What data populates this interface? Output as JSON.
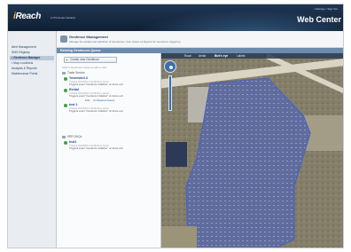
{
  "header": {
    "logo_prefix": "i",
    "logo_name": "Reach",
    "subtitle": "A ITS Series Solution",
    "top_links": "• Settings  • Sign Out",
    "app_title": "Web Center"
  },
  "sidebar": {
    "items": [
      {
        "label": "Alert Management",
        "active": false
      },
      {
        "label": "SMS Registry",
        "active": false
      },
      {
        "label": "• Geofence Manager",
        "active": true
      },
      {
        "label": "• Map Locations",
        "active": false
      },
      {
        "label": "Analysis & Reports",
        "active": false
      },
      {
        "label": "Maintenance Portal",
        "active": false
      }
    ]
  },
  "page": {
    "title": "Geofence Management",
    "description": "Manage the details and definition of Geofences, their states configured for Geofence triggering"
  },
  "section": {
    "title": "Existing Geofences Queue"
  },
  "list": {
    "create_label": "Create new Geofence",
    "hint": "Click a Geofence name to edit or view",
    "groups": [
      {
        "header": "Trade Service",
        "items": [
          {
            "name": "Yosemite4.3",
            "meta": "Created 2014/03/14 16:08:48 by admin",
            "trigger": "Triggers event \"Geofence Violation\" on fence exit",
            "links": []
          },
          {
            "name": "Rental",
            "meta": "Created 2014/03/14 16:08:48 by admin",
            "trigger": "Triggers event \"Geofence Violation\" on fence exit",
            "links": [
              "Edit",
              "Configured Assets"
            ]
          },
          {
            "name": "test 1",
            "meta": "Created 2014/03/14 16:08:48 by admin",
            "trigger": "Triggers event \"Geofence Violation\" on fence exit",
            "links": []
          }
        ]
      },
      {
        "header": "SRR DHQc",
        "items": [
          {
            "name": "test1",
            "meta": "Created 2014/03/14 16:08:48 by admin",
            "trigger": "Triggers event \"Geofence Violation\" on fence exit",
            "links": []
          }
        ]
      }
    ]
  },
  "map": {
    "toolbar": [
      {
        "label": "Road",
        "selected": false
      },
      {
        "label": "Aerial",
        "selected": false
      },
      {
        "label": "Bird's eye",
        "selected": true
      },
      {
        "label": "Labels",
        "selected": false
      }
    ],
    "geofence_color": "#4d63b8",
    "road_color": "#d9d4c4"
  },
  "colors": {
    "header_bg": "#16283f",
    "accent": "#f3b53b",
    "link": "#2f64a8",
    "active_dot": "#3fa23a"
  }
}
